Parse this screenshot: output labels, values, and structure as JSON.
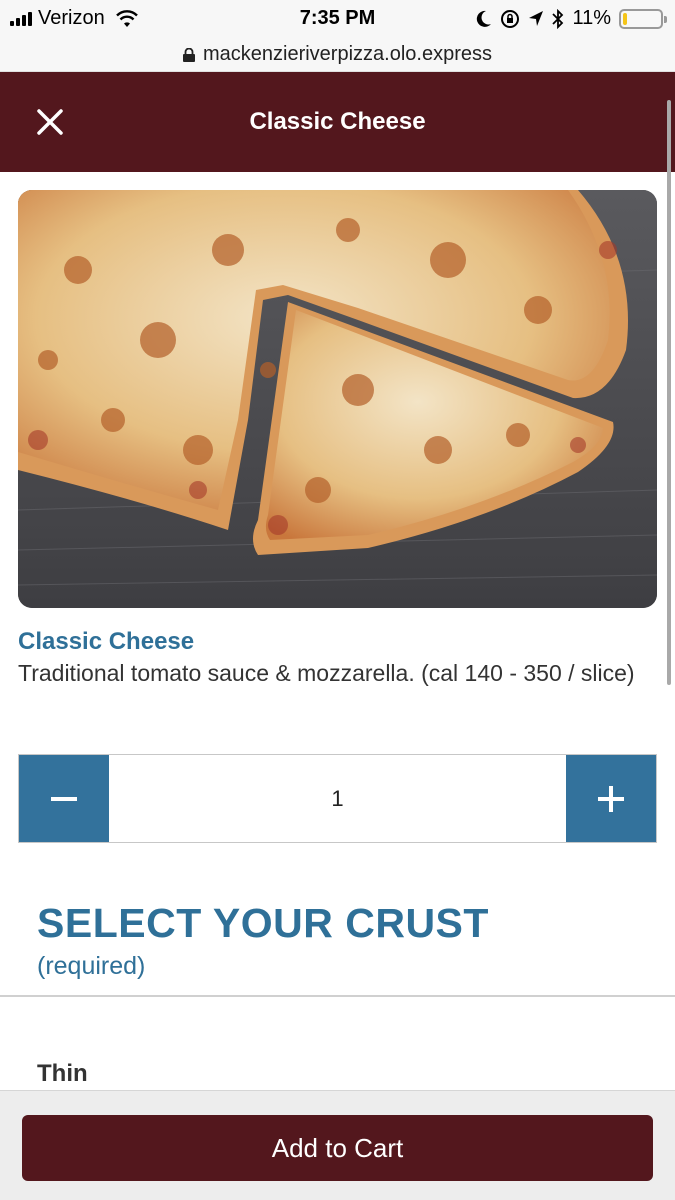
{
  "status_bar": {
    "carrier": "Verizon",
    "time": "7:35 PM",
    "battery_percent": "11%",
    "battery_level": 0.11,
    "icons": [
      "signal-icon",
      "wifi-icon",
      "moon-icon",
      "rotation-lock-icon",
      "location-arrow-icon",
      "bluetooth-icon",
      "battery-icon"
    ]
  },
  "browser": {
    "url": "mackenzieriverpizza.olo.express"
  },
  "header": {
    "title": "Classic Cheese",
    "close_icon": "close-icon",
    "bg_color": "#53171d"
  },
  "product": {
    "name": "Classic Cheese",
    "description": "Traditional tomato sauce & mozzarella. (cal 140 - 350 / slice)",
    "image": "classic-cheese-pizza-photo"
  },
  "quantity": {
    "value": "1",
    "minus_icon": "minus-icon",
    "plus_icon": "plus-icon",
    "accent_color": "#33729c"
  },
  "crust_section": {
    "title": "SELECT YOUR CRUST",
    "subtitle": "(required)",
    "options": [
      {
        "label": "Thin"
      }
    ]
  },
  "footer": {
    "add_to_cart_label": "Add to Cart"
  }
}
